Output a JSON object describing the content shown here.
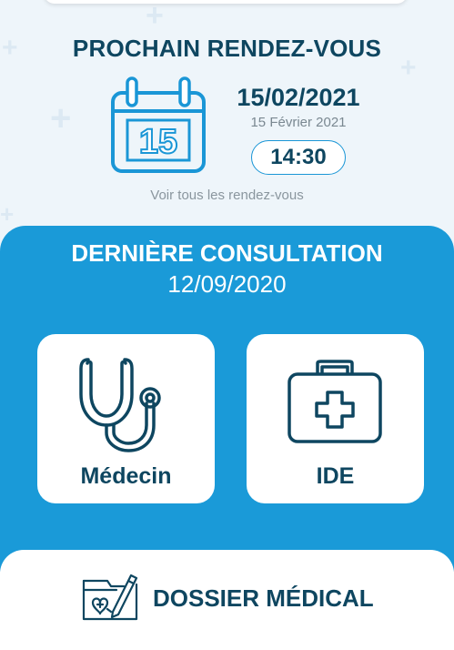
{
  "next_appointment": {
    "title": "PROCHAIN RENDEZ-VOUS",
    "calendar_day": "15",
    "date": "15/02/2021",
    "date_long": "15 Février 2021",
    "time": "14:30",
    "see_all_link": "Voir tous les rendez-vous",
    "calendar_icon": "calendar-icon"
  },
  "last_consultation": {
    "title": "DERNIÈRE CONSULTATION",
    "date": "12/09/2020",
    "tiles": [
      {
        "label": "Médecin",
        "icon": "stethoscope-icon"
      },
      {
        "label": "IDE",
        "icon": "medical-kit-icon"
      }
    ]
  },
  "medical_record": {
    "label": "DOSSIER MÉDICAL",
    "icon": "medical-record-icon"
  },
  "colors": {
    "primary_dark": "#0e4660",
    "accent_blue": "#1a9ad8",
    "icon_blue": "#1a96d6",
    "background": "#eef5fa"
  }
}
